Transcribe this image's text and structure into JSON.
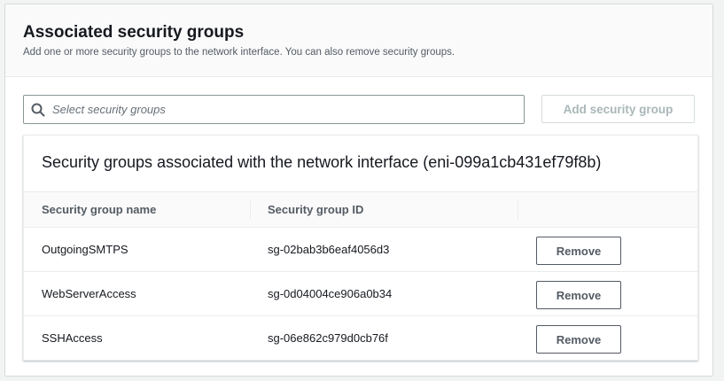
{
  "header": {
    "title": "Associated security groups",
    "description": "Add one or more security groups to the network interface. You can also remove security groups."
  },
  "search": {
    "placeholder": "Select security groups",
    "value": "",
    "icon": "search-icon"
  },
  "add_button_label": "Add security group",
  "table": {
    "title": "Security groups associated with the network interface (eni-099a1cb431ef79f8b)",
    "columns": [
      "Security group name",
      "Security group ID"
    ],
    "rows": [
      {
        "name": "OutgoingSMTPS",
        "id": "sg-02bab3b6eaf4056d3",
        "action": "Remove"
      },
      {
        "name": "WebServerAccess",
        "id": "sg-0d04004ce906a0b34",
        "action": "Remove"
      },
      {
        "name": "SSHAccess",
        "id": "sg-06e862c979d0cb76f",
        "action": "Remove"
      }
    ]
  },
  "colors": {
    "text": "#16191f",
    "secondary_text": "#545b64",
    "disabled_text": "#aab7b8",
    "border": "#879596",
    "panel_bg": "#ffffff",
    "page_bg": "#f2f3f3"
  }
}
